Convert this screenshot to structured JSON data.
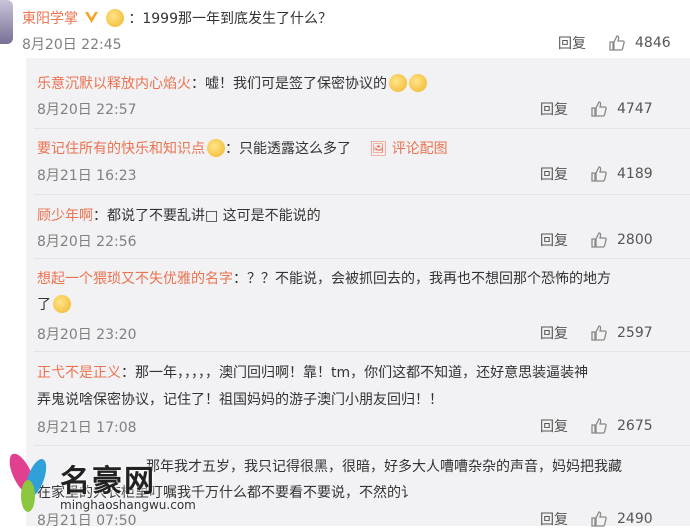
{
  "main_post": {
    "user": "東阳学掌",
    "text": "：1999那一年到底发生了什么？",
    "time": "8月20日 22:45",
    "reply": "回复",
    "likes": "4846"
  },
  "comments": [
    {
      "user": "乐意沉默以释放内心焰火",
      "text": "：嘘！我们可是签了保密协议的",
      "time": "8月20日 22:57",
      "reply": "回复",
      "likes": "4747"
    },
    {
      "user": "要记住所有的快乐和知识点",
      "text": "：只能透露这么多了",
      "pic": "评论配图",
      "time": "8月21日 16:23",
      "reply": "回复",
      "likes": "4189"
    },
    {
      "user": "顾少年啊",
      "text": "：都说了不要乱讲□ 这可是不能说的",
      "time": "8月20日 22:56",
      "reply": "回复",
      "likes": "2800"
    },
    {
      "user": "想起一个猥琐又不失优雅的名字",
      "text": "：？？不能说，会被抓回去的，我再也不想回那个恐怖的地方",
      "text2": "了",
      "time": "8月20日 23:20",
      "reply": "回复",
      "likes": "2597"
    },
    {
      "user": "正弋不是正义",
      "text": "：那一年，，，，，澳门回归啊！靠！tm，你们这都不知道，还好意思装逼装神",
      "text2": "弄鬼说啥保密协议，记住了！祖国妈妈的游子澳门小朋友回归！！",
      "time": "8月21日 17:08",
      "reply": "回复",
      "likes": "2675"
    },
    {
      "user": "",
      "text": "那年我才五岁，我只记得很黑，很暗，好多大人嘈嘈杂杂的声音，妈妈把我藏",
      "text2": "在家里的大衣柜里叮嘱我千万什么都不要看不要说，不然的讠",
      "time": "8月21日 07:50",
      "reply": "回复",
      "likes": "2490"
    }
  ],
  "watermark": {
    "title": "名豪网",
    "url": "minghaoshangwu.com"
  },
  "colors": {
    "username": "#eb7350",
    "panel": "#f2f2f5",
    "meta": "#808080"
  }
}
